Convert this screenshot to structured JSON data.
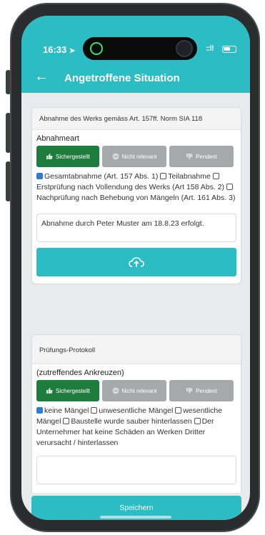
{
  "status_bar": {
    "time": "16:33",
    "signal": "::!!",
    "location_arrow": "location-arrow-icon"
  },
  "app_bar": {
    "back_icon": "arrow-left-icon",
    "title": "Angetroffene Situation"
  },
  "card1": {
    "heading": "Abnahme des Werks gemäss Art. 157ff. Norm SIA 118",
    "label": "Abnahmeart",
    "status_buttons": [
      {
        "label": "Sichergestellt",
        "icon": "thumbs-up-icon",
        "active": true
      },
      {
        "label": "Nicht relevant",
        "icon": "minus-circle-icon",
        "active": false
      },
      {
        "label": "Pendent",
        "icon": "thumbs-down-icon",
        "active": false
      }
    ],
    "options": [
      {
        "label": "Gesamtabnahme (Art. 157 Abs. 1)",
        "checked": true
      },
      {
        "label": "Teilabnahme",
        "checked": false
      },
      {
        "label": "Erstprüfung nach Vollendung des Werks (Art 158 Abs. 2)",
        "checked": false
      },
      {
        "label": "Nachprüfung nach Behebung von Mängeln (Art. 161 Abs. 3)",
        "checked": false
      }
    ],
    "note": "Abnahme durch Peter Muster am 18.8.23 erfolgt.",
    "upload_icon": "cloud-upload-icon"
  },
  "card2": {
    "heading": "Prüfungs-Protokoll",
    "label": "(zutreffendes Ankreuzen)",
    "status_buttons": [
      {
        "label": "Sichergestellt",
        "icon": "thumbs-up-icon",
        "active": true
      },
      {
        "label": "Nicht relevant",
        "icon": "minus-circle-icon",
        "active": false
      },
      {
        "label": "Pendent",
        "icon": "thumbs-down-icon",
        "active": false
      }
    ],
    "options": [
      {
        "label": "keine Mängel",
        "checked": true
      },
      {
        "label": "unwesentliche Mängel",
        "checked": false
      },
      {
        "label": "wesentliche Mängel",
        "checked": false
      },
      {
        "label": "Baustelle wurde sauber hinterlassen",
        "checked": false
      },
      {
        "label": "Der Unternehmer hat keine Schäden an Werken Dritter verursacht / hinterlassen",
        "checked": false
      }
    ]
  },
  "footer": {
    "save_label": "Speichern"
  },
  "colors": {
    "accent": "#2cbcc3",
    "active_green": "#1e7d3c",
    "inactive_gray": "#a7a8aa",
    "checkbox_blue": "#2a7cd6"
  }
}
